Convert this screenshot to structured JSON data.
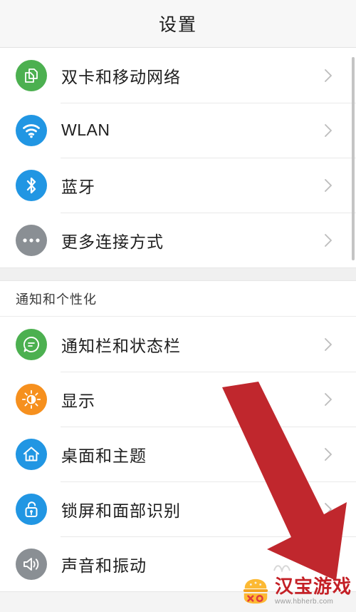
{
  "header": {
    "title": "设置"
  },
  "colors": {
    "green": "#4cb050",
    "blue": "#2196e3",
    "blue_dark": "#1c8ad6",
    "gray": "#8a8f94",
    "orange": "#f6901e",
    "arrow_red": "#c0272d",
    "watermark_red": "#c42026",
    "chevron": "#bdbdbd",
    "divider": "#e9e9e9",
    "band": "#f0f0f0",
    "header_bg": "#f7f7f7"
  },
  "groups": [
    {
      "section_label": null,
      "items": [
        {
          "label": "双卡和移动网络",
          "icon": "dual-sim-icon",
          "icon_color": "#4cb050",
          "chevron": "chevron-right-icon",
          "latin": false
        },
        {
          "label": "WLAN",
          "icon": "wifi-icon",
          "icon_color": "#2196e3",
          "chevron": "chevron-right-icon",
          "latin": true
        },
        {
          "label": "蓝牙",
          "icon": "bluetooth-icon",
          "icon_color": "#2196e3",
          "chevron": "chevron-right-icon",
          "latin": false
        },
        {
          "label": "更多连接方式",
          "icon": "more-dots-icon",
          "icon_color": "#8a8f94",
          "chevron": "chevron-right-icon",
          "latin": false
        }
      ]
    },
    {
      "section_label": "通知和个性化",
      "items": [
        {
          "label": "通知栏和状态栏",
          "icon": "notification-bubble-icon",
          "icon_color": "#4cb050",
          "chevron": "chevron-right-icon",
          "latin": false
        },
        {
          "label": "显示",
          "icon": "brightness-sun-icon",
          "icon_color": "#f6901e",
          "chevron": "chevron-right-icon",
          "latin": false
        },
        {
          "label": "桌面和主题",
          "icon": "home-icon",
          "icon_color": "#2196e3",
          "chevron": "chevron-right-icon",
          "latin": false
        },
        {
          "label": "锁屏和面部识别",
          "icon": "lock-icon",
          "icon_color": "#2196e3",
          "chevron": "chevron-right-icon",
          "latin": false
        },
        {
          "label": "声音和振动",
          "icon": "speaker-volume-icon",
          "icon_color": "#8a8f94",
          "chevron": "chevron-right-icon",
          "latin": false
        }
      ]
    }
  ],
  "annotation": {
    "arrow": "red-down-right-arrow"
  },
  "watermark": {
    "brand": "汉宝游戏",
    "url": "www.hbherb.com",
    "logo": "burger-logo-icon"
  }
}
